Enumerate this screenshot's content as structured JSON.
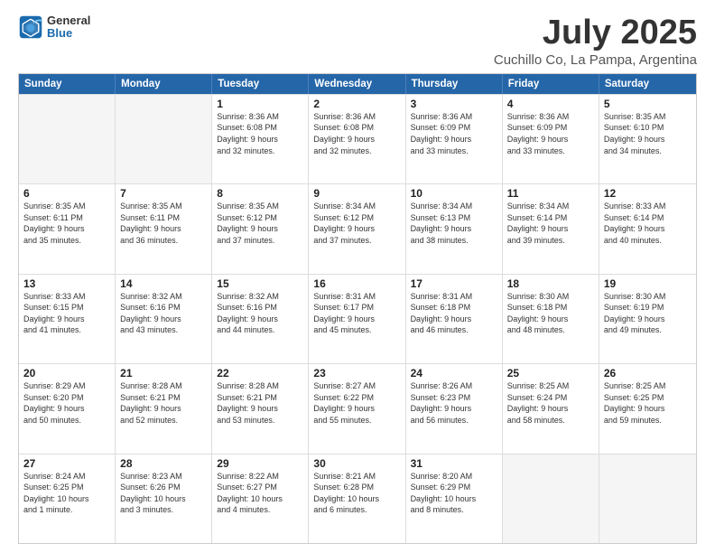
{
  "header": {
    "logo_line1": "General",
    "logo_line2": "Blue",
    "title": "July 2025",
    "subtitle": "Cuchillo Co, La Pampa, Argentina"
  },
  "calendar": {
    "days_of_week": [
      "Sunday",
      "Monday",
      "Tuesday",
      "Wednesday",
      "Thursday",
      "Friday",
      "Saturday"
    ],
    "rows": [
      [
        {
          "day": "",
          "info": "",
          "empty": true
        },
        {
          "day": "",
          "info": "",
          "empty": true
        },
        {
          "day": "1",
          "info": "Sunrise: 8:36 AM\nSunset: 6:08 PM\nDaylight: 9 hours\nand 32 minutes."
        },
        {
          "day": "2",
          "info": "Sunrise: 8:36 AM\nSunset: 6:08 PM\nDaylight: 9 hours\nand 32 minutes."
        },
        {
          "day": "3",
          "info": "Sunrise: 8:36 AM\nSunset: 6:09 PM\nDaylight: 9 hours\nand 33 minutes."
        },
        {
          "day": "4",
          "info": "Sunrise: 8:36 AM\nSunset: 6:09 PM\nDaylight: 9 hours\nand 33 minutes."
        },
        {
          "day": "5",
          "info": "Sunrise: 8:35 AM\nSunset: 6:10 PM\nDaylight: 9 hours\nand 34 minutes."
        }
      ],
      [
        {
          "day": "6",
          "info": "Sunrise: 8:35 AM\nSunset: 6:11 PM\nDaylight: 9 hours\nand 35 minutes."
        },
        {
          "day": "7",
          "info": "Sunrise: 8:35 AM\nSunset: 6:11 PM\nDaylight: 9 hours\nand 36 minutes."
        },
        {
          "day": "8",
          "info": "Sunrise: 8:35 AM\nSunset: 6:12 PM\nDaylight: 9 hours\nand 37 minutes."
        },
        {
          "day": "9",
          "info": "Sunrise: 8:34 AM\nSunset: 6:12 PM\nDaylight: 9 hours\nand 37 minutes."
        },
        {
          "day": "10",
          "info": "Sunrise: 8:34 AM\nSunset: 6:13 PM\nDaylight: 9 hours\nand 38 minutes."
        },
        {
          "day": "11",
          "info": "Sunrise: 8:34 AM\nSunset: 6:14 PM\nDaylight: 9 hours\nand 39 minutes."
        },
        {
          "day": "12",
          "info": "Sunrise: 8:33 AM\nSunset: 6:14 PM\nDaylight: 9 hours\nand 40 minutes."
        }
      ],
      [
        {
          "day": "13",
          "info": "Sunrise: 8:33 AM\nSunset: 6:15 PM\nDaylight: 9 hours\nand 41 minutes."
        },
        {
          "day": "14",
          "info": "Sunrise: 8:32 AM\nSunset: 6:16 PM\nDaylight: 9 hours\nand 43 minutes."
        },
        {
          "day": "15",
          "info": "Sunrise: 8:32 AM\nSunset: 6:16 PM\nDaylight: 9 hours\nand 44 minutes."
        },
        {
          "day": "16",
          "info": "Sunrise: 8:31 AM\nSunset: 6:17 PM\nDaylight: 9 hours\nand 45 minutes."
        },
        {
          "day": "17",
          "info": "Sunrise: 8:31 AM\nSunset: 6:18 PM\nDaylight: 9 hours\nand 46 minutes."
        },
        {
          "day": "18",
          "info": "Sunrise: 8:30 AM\nSunset: 6:18 PM\nDaylight: 9 hours\nand 48 minutes."
        },
        {
          "day": "19",
          "info": "Sunrise: 8:30 AM\nSunset: 6:19 PM\nDaylight: 9 hours\nand 49 minutes."
        }
      ],
      [
        {
          "day": "20",
          "info": "Sunrise: 8:29 AM\nSunset: 6:20 PM\nDaylight: 9 hours\nand 50 minutes."
        },
        {
          "day": "21",
          "info": "Sunrise: 8:28 AM\nSunset: 6:21 PM\nDaylight: 9 hours\nand 52 minutes."
        },
        {
          "day": "22",
          "info": "Sunrise: 8:28 AM\nSunset: 6:21 PM\nDaylight: 9 hours\nand 53 minutes."
        },
        {
          "day": "23",
          "info": "Sunrise: 8:27 AM\nSunset: 6:22 PM\nDaylight: 9 hours\nand 55 minutes."
        },
        {
          "day": "24",
          "info": "Sunrise: 8:26 AM\nSunset: 6:23 PM\nDaylight: 9 hours\nand 56 minutes."
        },
        {
          "day": "25",
          "info": "Sunrise: 8:25 AM\nSunset: 6:24 PM\nDaylight: 9 hours\nand 58 minutes."
        },
        {
          "day": "26",
          "info": "Sunrise: 8:25 AM\nSunset: 6:25 PM\nDaylight: 9 hours\nand 59 minutes."
        }
      ],
      [
        {
          "day": "27",
          "info": "Sunrise: 8:24 AM\nSunset: 6:25 PM\nDaylight: 10 hours\nand 1 minute."
        },
        {
          "day": "28",
          "info": "Sunrise: 8:23 AM\nSunset: 6:26 PM\nDaylight: 10 hours\nand 3 minutes."
        },
        {
          "day": "29",
          "info": "Sunrise: 8:22 AM\nSunset: 6:27 PM\nDaylight: 10 hours\nand 4 minutes."
        },
        {
          "day": "30",
          "info": "Sunrise: 8:21 AM\nSunset: 6:28 PM\nDaylight: 10 hours\nand 6 minutes."
        },
        {
          "day": "31",
          "info": "Sunrise: 8:20 AM\nSunset: 6:29 PM\nDaylight: 10 hours\nand 8 minutes."
        },
        {
          "day": "",
          "info": "",
          "empty": true
        },
        {
          "day": "",
          "info": "",
          "empty": true
        }
      ]
    ]
  }
}
